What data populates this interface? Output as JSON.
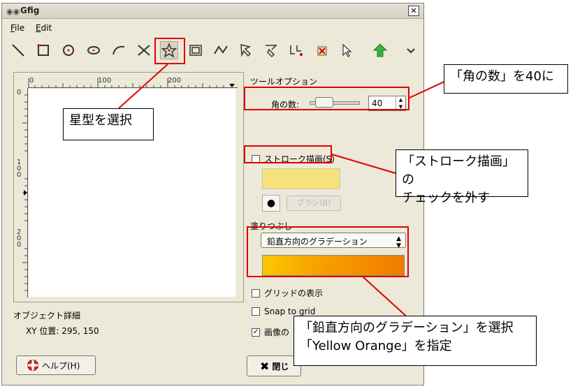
{
  "window": {
    "title": "Gfig",
    "close_glyph": "✕"
  },
  "menu": {
    "file": "File",
    "edit": "Edit"
  },
  "toolbar": {
    "tools": [
      "line-icon",
      "rectangle-icon",
      "circle-icon",
      "ellipse-icon",
      "arc-icon",
      "polygon-icon",
      "star-icon",
      "spiral-icon",
      "bezier-icon",
      "move-object-icon",
      "move-point-icon",
      "copy-icon",
      "delete-icon",
      "select-icon",
      "raise-icon",
      "more-icon"
    ],
    "active_tool": "star-icon"
  },
  "canvas": {
    "h_ticks": [
      "0",
      "100",
      "200"
    ],
    "v_ticks": [
      "0",
      "1\n0\n0",
      "2\n0\n0"
    ]
  },
  "info": {
    "object_details": "オブジェクト詳細",
    "xy_position": "XY 位置: 295, 150"
  },
  "options": {
    "title": "ツールオプション",
    "points_label": "角の数:",
    "points_value": "40",
    "stroke_label": "ストローク描画(S)",
    "stroke_checked": false,
    "stroke_color": "#f6e27c",
    "brush_button": "ブラシ(B)",
    "fill_label": "塗りつぶし",
    "fill_mode": "鉛直方向のグラデーション",
    "gradient_colors": [
      "#fac800",
      "#f8a000",
      "#ef7a00"
    ],
    "show_grid": "グリッドの表示",
    "snap_to_grid": "Snap to grid",
    "show_image": "画像の"
  },
  "buttons": {
    "help": "ヘルプ(H)",
    "close": "閉じ"
  },
  "callouts": {
    "star": "星型を選択",
    "points": "「角の数」を40に",
    "stroke_line1": "「ストローク描画」の",
    "stroke_line2": "チェックを外す",
    "gradient_line1": "「鉛直方向のグラデーション」を選択",
    "gradient_line2": "「Yellow Orange」を指定"
  }
}
